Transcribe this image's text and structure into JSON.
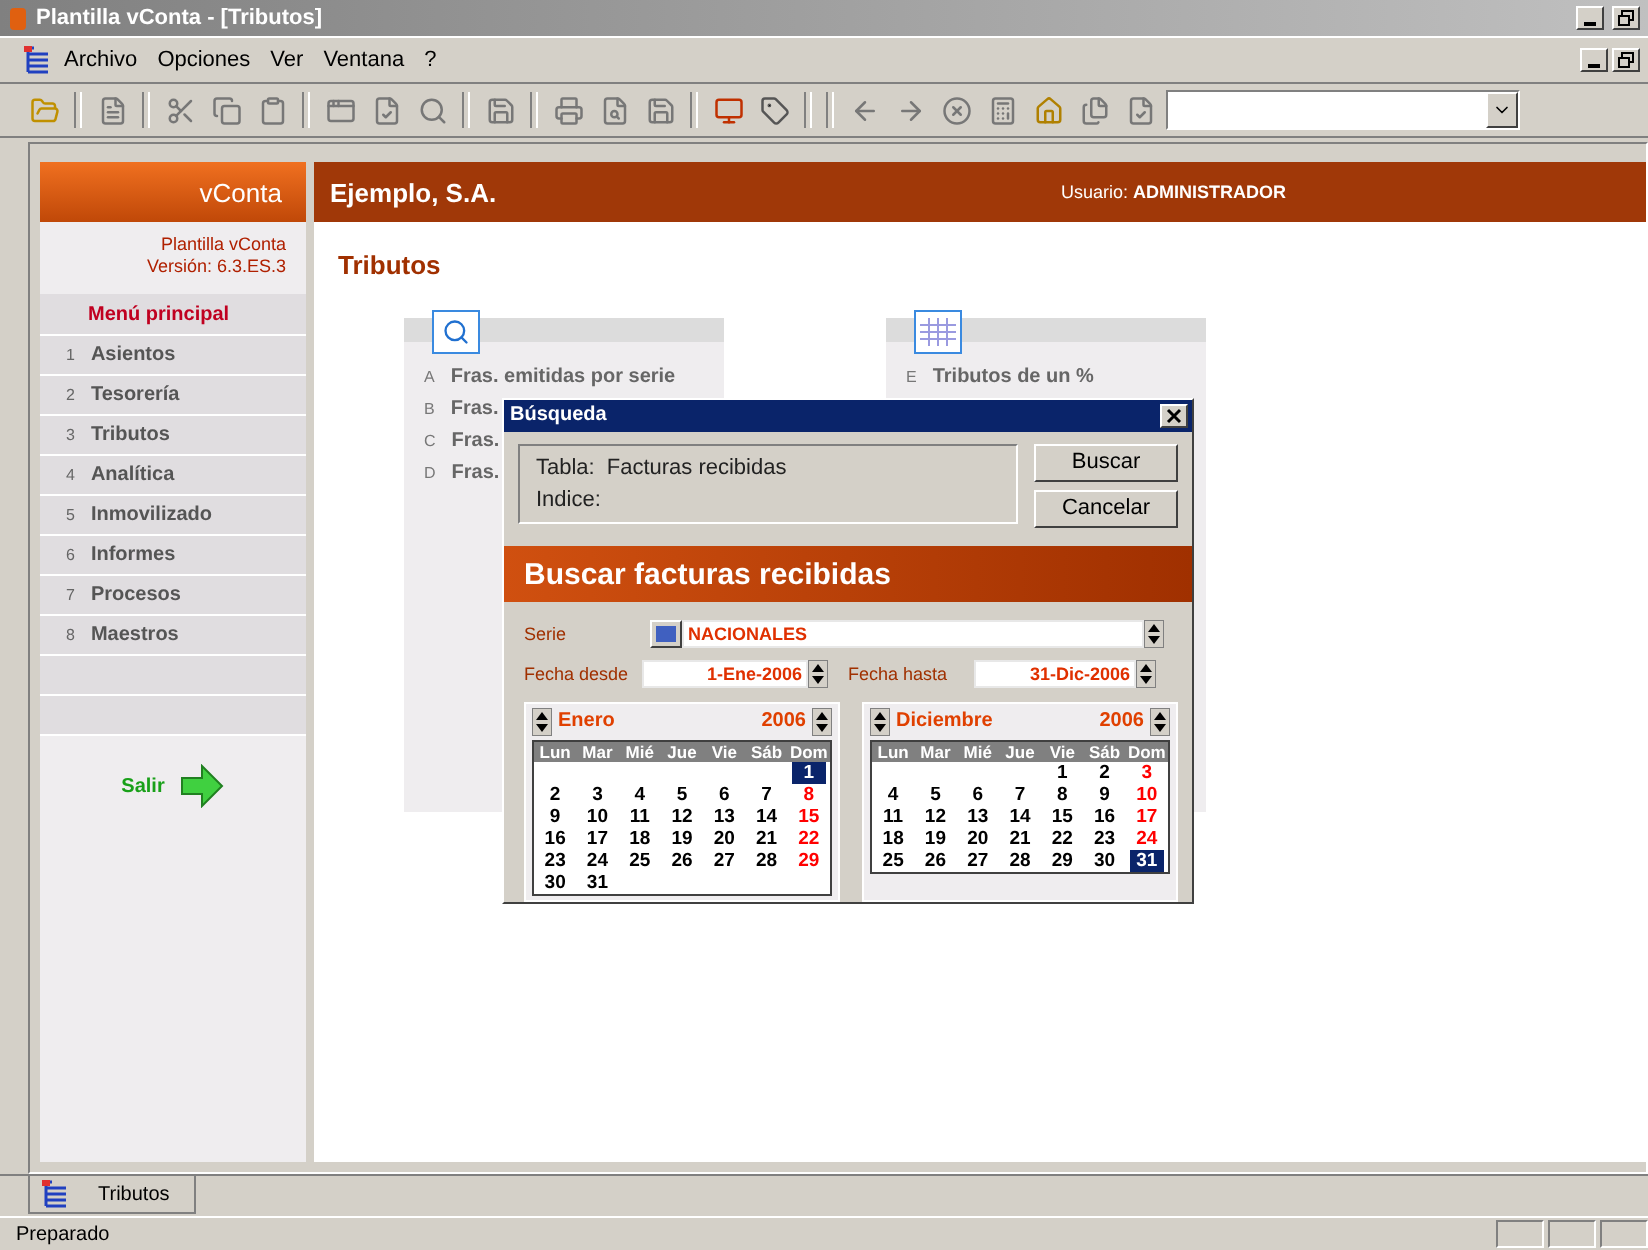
{
  "window": {
    "title": "Plantilla vConta - [Tributos]"
  },
  "menu": [
    {
      "label": "Archivo"
    },
    {
      "label": "Opciones"
    },
    {
      "label": "Ver"
    },
    {
      "label": "Ventana"
    },
    {
      "label": "?"
    }
  ],
  "sidebar": {
    "brand": "vConta",
    "template": "Plantilla vConta",
    "version": "Versión: 6.3.ES.3",
    "menu_title": "Menú principal",
    "items": [
      {
        "number": "1",
        "label": "Asientos"
      },
      {
        "number": "2",
        "label": "Tesorería"
      },
      {
        "number": "3",
        "label": "Tributos"
      },
      {
        "number": "4",
        "label": "Analítica"
      },
      {
        "number": "5",
        "label": "Inmovilizado"
      },
      {
        "number": "6",
        "label": "Informes"
      },
      {
        "number": "7",
        "label": "Procesos"
      },
      {
        "number": "8",
        "label": "Maestros"
      }
    ],
    "exit": "Salir"
  },
  "header": {
    "company": "Ejemplo, S.A.",
    "user": "Usuario: **ADMINISTRADOR**"
  },
  "page_title": "Tributos",
  "panels": [
    {
      "kind": "search",
      "items": [
        {
          "letter": "A",
          "label": "Fras. emitidas por serie"
        },
        {
          "letter": "B",
          "label": "Fras."
        },
        {
          "letter": "C",
          "label": "Fras."
        },
        {
          "letter": "D",
          "label": "Fras."
        }
      ]
    },
    {
      "kind": "calendar",
      "items": [
        {
          "letter": "E",
          "label": "Tributos de un %"
        }
      ]
    }
  ],
  "dialog": {
    "title": "Búsqueda",
    "table_label": "Tabla:",
    "table_value": "Facturas recibidas",
    "index_label": "Indice:",
    "buttons": [
      "Buscar",
      "Cancelar"
    ],
    "banner": "Buscar facturas recibidas",
    "serie_label": "Serie",
    "serie_value": "NACIONALES",
    "from_label": "Fecha desde",
    "from_value": "1-Ene-2006",
    "to_label": "Fecha hasta",
    "to_value": "31-Dic-2006",
    "calendars": [
      {
        "month": "Enero",
        "year": "2006",
        "weekdays": [
          "Lun",
          "Mar",
          "Mié",
          "Jue",
          "Vie",
          "Sáb",
          "Dom"
        ],
        "weeks": [
          [
            {
              "d": "1",
              "selected": true
            }
          ],
          [
            {
              "d": "2",
              "selected": false
            },
            {
              "d": "3",
              "selected": false
            },
            {
              "d": "4",
              "selected": false
            },
            {
              "d": "5",
              "selected": false
            },
            {
              "d": "6",
              "selected": false
            },
            {
              "d": "7",
              "selected": false
            },
            {
              "d": "8",
              "selected": false
            }
          ],
          [
            {
              "d": "9",
              "selected": false
            },
            {
              "d": "10",
              "selected": false
            },
            {
              "d": "11",
              "selected": false
            },
            {
              "d": "12",
              "selected": false
            },
            {
              "d": "13",
              "selected": false
            },
            {
              "d": "14",
              "selected": false
            },
            {
              "d": "15",
              "selected": false
            }
          ],
          [
            {
              "d": "16",
              "selected": false
            },
            {
              "d": "17",
              "selected": false
            },
            {
              "d": "18",
              "selected": false
            },
            {
              "d": "19",
              "selected": false
            },
            {
              "d": "20",
              "selected": false
            },
            {
              "d": "21",
              "selected": false
            },
            {
              "d": "22",
              "selected": false
            }
          ],
          [
            {
              "d": "23",
              "selected": false
            },
            {
              "d": "24",
              "selected": false
            },
            {
              "d": "25",
              "selected": false
            },
            {
              "d": "26",
              "selected": false
            },
            {
              "d": "27",
              "selected": false
            },
            {
              "d": "28",
              "selected": false
            },
            {
              "d": "29",
              "selected": false
            }
          ],
          [
            {
              "d": "30",
              "selected": false
            },
            {
              "d": "31",
              "selected": false
            }
          ]
        ]
      },
      {
        "month": "Diciembre",
        "year": "2006",
        "weekdays": [
          "Lun",
          "Mar",
          "Mié",
          "Jue",
          "Vie",
          "Sáb",
          "Dom"
        ],
        "weeks": [
          [
            {
              "d": "1",
              "selected": false
            },
            {
              "d": "2",
              "selected": false
            },
            {
              "d": "3",
              "selected": false
            }
          ],
          [
            {
              "d": "4",
              "selected": false
            },
            {
              "d": "5",
              "selected": false
            },
            {
              "d": "6",
              "selected": false
            },
            {
              "d": "7",
              "selected": false
            },
            {
              "d": "8",
              "selected": false
            },
            {
              "d": "9",
              "selected": false
            },
            {
              "d": "10",
              "selected": false
            }
          ],
          [
            {
              "d": "11",
              "selected": false
            },
            {
              "d": "12",
              "selected": false
            },
            {
              "d": "13",
              "selected": false
            },
            {
              "d": "14",
              "selected": false
            },
            {
              "d": "15",
              "selected": false
            },
            {
              "d": "16",
              "selected": false
            },
            {
              "d": "17",
              "selected": false
            }
          ],
          [
            {
              "d": "18",
              "selected": false
            },
            {
              "d": "19",
              "selected": false
            },
            {
              "d": "20",
              "selected": false
            },
            {
              "d": "21",
              "selected": false
            },
            {
              "d": "22",
              "selected": false
            },
            {
              "d": "23",
              "selected": false
            },
            {
              "d": "24",
              "selected": false
            }
          ],
          [
            {
              "d": "25",
              "selected": false
            },
            {
              "d": "26",
              "selected": false
            },
            {
              "d": "27",
              "selected": false
            },
            {
              "d": "28",
              "selected": false
            },
            {
              "d": "29",
              "selected": false
            },
            {
              "d": "30",
              "selected": false
            },
            {
              "d": "31",
              "selected": true
            }
          ]
        ]
      }
    ]
  },
  "tabs": [
    {
      "label": "Tributos",
      "selected": true
    }
  ],
  "status_bar": {
    "text": "Preparado"
  }
}
